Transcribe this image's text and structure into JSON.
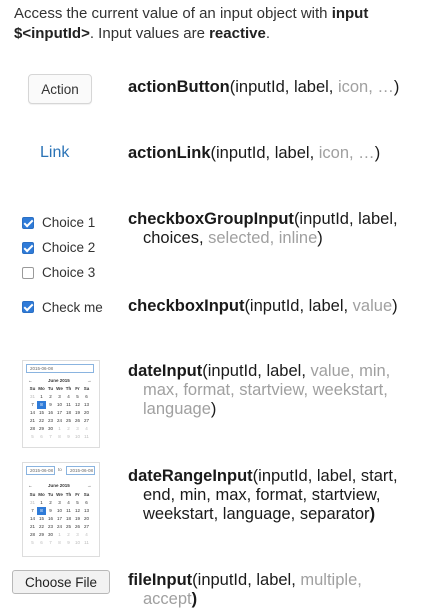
{
  "intro": {
    "t1": "Access the current value of an input object with ",
    "b1": "input $<inputId>",
    "t2": ". Input values are ",
    "b2": "reactive",
    "t3": "."
  },
  "widgets": {
    "action_button": "Action",
    "action_link": "Link",
    "choices": [
      {
        "label": "Choice 1",
        "checked": true
      },
      {
        "label": "Choice 2",
        "checked": true
      },
      {
        "label": "Choice 3",
        "checked": false
      }
    ],
    "check_me": "Check me",
    "file_button": "Choose File",
    "date": {
      "input_value": "2015-06-08",
      "range_start": "2015-06-08",
      "range_sep": "to",
      "range_end": "2015-06-08",
      "prev": "←",
      "month": "June 2015",
      "next": "→",
      "weekdays": [
        "Su",
        "Mo",
        "Tu",
        "We",
        "Th",
        "Fr",
        "Sa"
      ],
      "days": [
        "31",
        "1",
        "2",
        "3",
        "4",
        "5",
        "6",
        "7",
        "8",
        "9",
        "10",
        "11",
        "12",
        "13",
        "14",
        "15",
        "16",
        "17",
        "18",
        "19",
        "20",
        "21",
        "22",
        "23",
        "24",
        "25",
        "26",
        "27",
        "28",
        "29",
        "30",
        "1",
        "2",
        "3",
        "4",
        "5",
        "6",
        "7",
        "8",
        "9",
        "10",
        "11"
      ]
    }
  },
  "functions": {
    "actionButton": {
      "name": "actionButton",
      "open": "(inputId, label, ",
      "opt": "icon, …",
      "close": ")"
    },
    "actionLink": {
      "name": "actionLink",
      "open": "(inputId, label, ",
      "opt": "icon, …",
      "close": ")"
    },
    "checkboxGroupInput": {
      "name": "checkboxGroupInput",
      "open": "(inputId, label,",
      "line2": "choices, ",
      "opt": "selected, inline",
      "close": ")"
    },
    "checkboxInput": {
      "name": "checkboxInput",
      "open": "(inputId, label, ",
      "opt": "value",
      "close": ")"
    },
    "dateInput": {
      "name": "dateInput",
      "open": "(inputId, label, ",
      "opt1": "value, min,",
      "opt2": "max, for",
      "opt2b": "mat, startview, weekstart,",
      "opt3": "language",
      "close": ")"
    },
    "dateRangeInput": {
      "name": "dateRangeInput",
      "l1": "(inputId, label, start,",
      "l2": "end, min, max, format, startview,",
      "l3": "weekstart, language, separator",
      "close": ")"
    },
    "fileInput": {
      "name": "fileInput",
      "open": "(inputId, label, ",
      "opt1": "multiple,",
      "opt2": "accept",
      "close": ")"
    }
  },
  "colors": {
    "link": "#2a73b6",
    "checkbox": "#2f7bd8",
    "optional_arg": "#a0a0a0"
  }
}
